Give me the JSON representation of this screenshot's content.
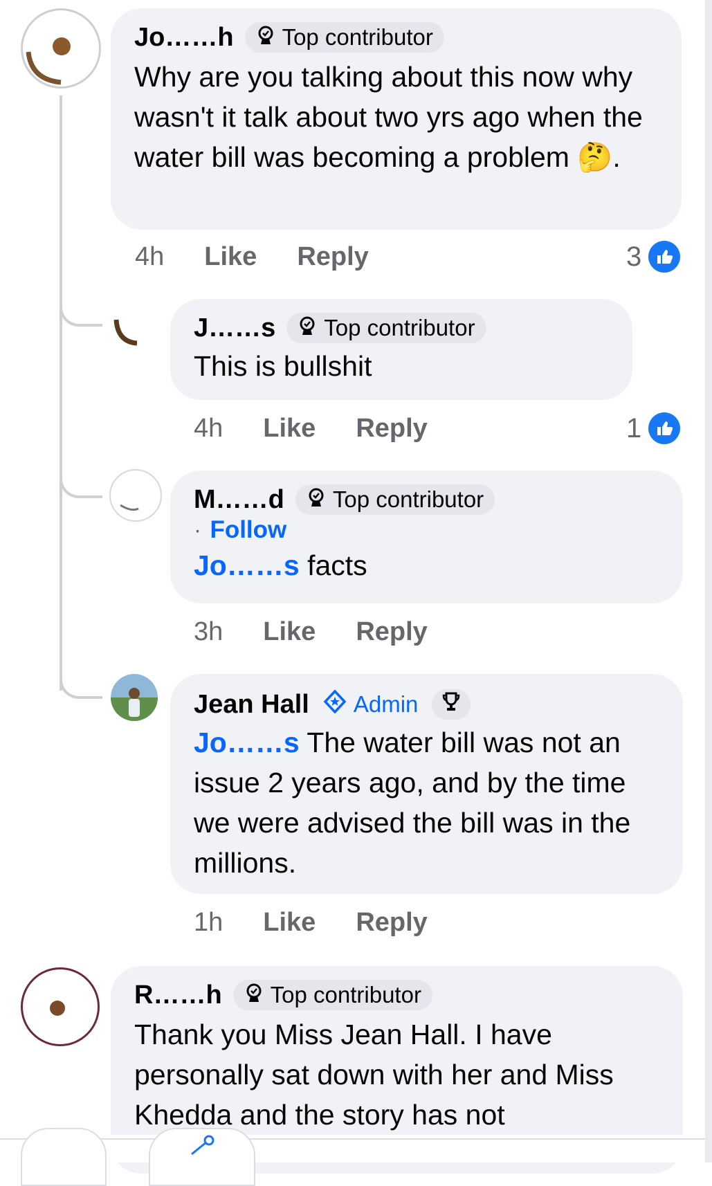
{
  "comments": [
    {
      "author": "Jo……h",
      "badge": "Top contributor",
      "text": "Why are you talking about this now why wasn't it talk about two yrs ago when the water bill was becoming  a problem 🤔.",
      "time": "4h",
      "like": "Like",
      "reply": "Reply",
      "reactions": "3"
    },
    {
      "author": "J……s",
      "badge": "Top contributor",
      "text": "This is bullshit",
      "time": "4h",
      "like": "Like",
      "reply": "Reply",
      "reactions": "1"
    },
    {
      "author": "M……d",
      "badge": "Top contributor",
      "follow": "Follow",
      "mention": "Jo……s",
      "text": "facts",
      "time": "3h",
      "like": "Like",
      "reply": "Reply"
    },
    {
      "author": "Jean Hall",
      "badge": "Admin",
      "mention": "Jo……s",
      "text": "The water bill was not an issue 2 years ago, and by the time we were advised the bill was in the millions.",
      "time": "1h",
      "like": "Like",
      "reply": "Reply"
    },
    {
      "author": "R……h",
      "badge": "Top contributor",
      "text": "Thank you Miss Jean Hall. I have personally sat down with her and Miss Khedda and the story has not"
    }
  ],
  "colors": {
    "link": "#0866ff",
    "bubble": "#f0f2f5",
    "meta": "#65676b",
    "reaction": "#1877f2"
  },
  "icons": {
    "badge": "contributor-badge-icon",
    "admin": "admin-shield-icon",
    "trophy": "trophy-icon",
    "reaction": "like-reaction-icon"
  }
}
